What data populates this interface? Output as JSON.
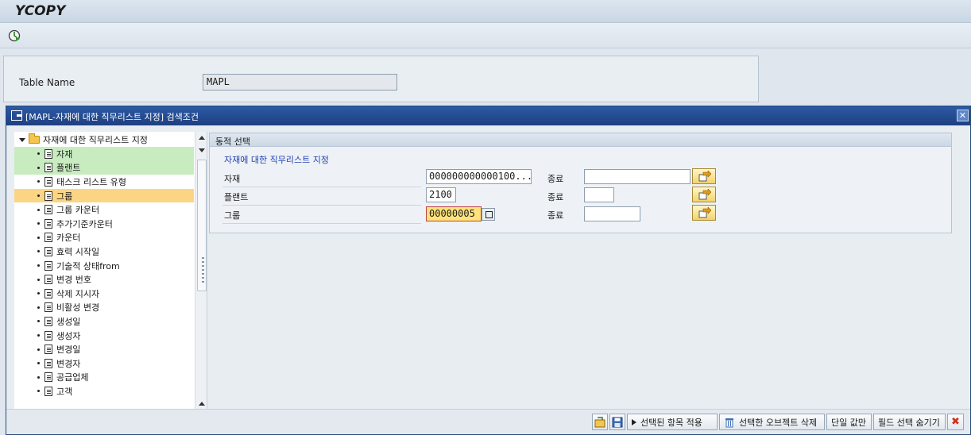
{
  "app": {
    "title": "YCOPY"
  },
  "table": {
    "label": "Table Name",
    "value": "MAPL"
  },
  "dialog": {
    "title": "[MAPL-자재에 대한 직무리스트 지정] 검색조건"
  },
  "tree": {
    "root": "자재에 대한 직무리스트 지정",
    "items": [
      {
        "label": "자재",
        "state": "selected"
      },
      {
        "label": "플랜트",
        "state": "selected"
      },
      {
        "label": "태스크 리스트 유형",
        "state": ""
      },
      {
        "label": "그룹",
        "state": "active"
      },
      {
        "label": "그룹 카운터",
        "state": ""
      },
      {
        "label": "추가기준카운터",
        "state": ""
      },
      {
        "label": "카운터",
        "state": ""
      },
      {
        "label": "효력 시작일",
        "state": ""
      },
      {
        "label": "기술적 상태from",
        "state": ""
      },
      {
        "label": "변경 번호",
        "state": ""
      },
      {
        "label": "삭제 지시자",
        "state": ""
      },
      {
        "label": "비활성 변경",
        "state": ""
      },
      {
        "label": "생성일",
        "state": ""
      },
      {
        "label": "생성자",
        "state": ""
      },
      {
        "label": "변경일",
        "state": ""
      },
      {
        "label": "변경자",
        "state": ""
      },
      {
        "label": "공급업체",
        "state": ""
      },
      {
        "label": "고객",
        "state": ""
      }
    ]
  },
  "dynamic": {
    "panel_title": "동적 선택",
    "group_title": "자재에 대한 직무리스트 지정",
    "rows": [
      {
        "label": "자재",
        "from": "000000000000100...",
        "to_label": "종료",
        "to": ""
      },
      {
        "label": "플랜트",
        "from": "2100",
        "to_label": "종료",
        "to": ""
      },
      {
        "label": "그룹",
        "from": "00000005",
        "to_label": "종료",
        "to": ""
      }
    ]
  },
  "footer": {
    "apply": "선택된 항목 적용",
    "delete": "선택한 오브젝트 삭제",
    "single": "단일 값만",
    "hide": "필드 선택 숨기기"
  }
}
